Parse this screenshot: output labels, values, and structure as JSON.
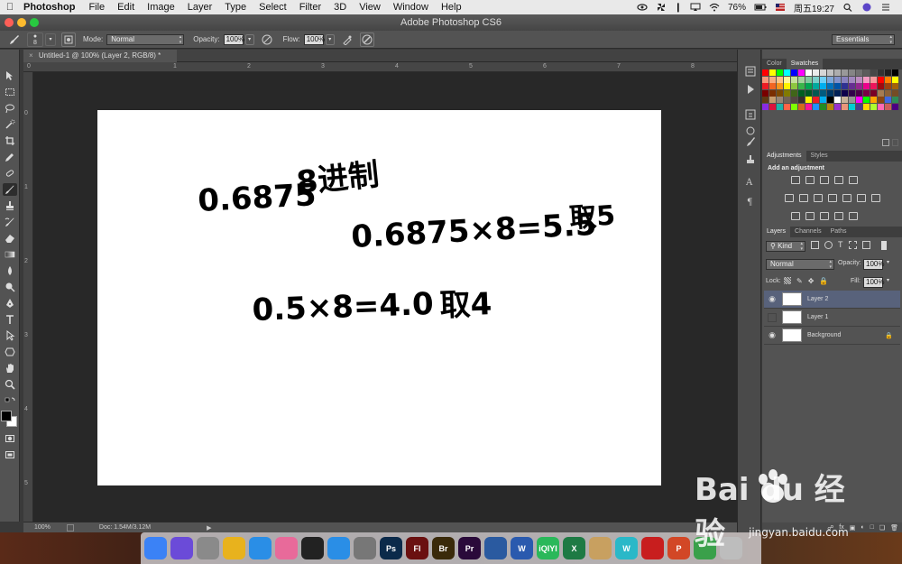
{
  "menubar": {
    "app_name": "Photoshop",
    "items": [
      "File",
      "Edit",
      "Image",
      "Layer",
      "Type",
      "Select",
      "Filter",
      "3D",
      "View",
      "Window",
      "Help"
    ],
    "battery": "76%",
    "clock": "周五19:27"
  },
  "window": {
    "title": "Adobe Photoshop CS6"
  },
  "options": {
    "brush_size": "8",
    "mode_label": "Mode:",
    "mode_value": "Normal",
    "opacity_label": "Opacity:",
    "opacity_value": "100%",
    "flow_label": "Flow:",
    "flow_value": "100%",
    "workspace": "Essentials"
  },
  "document": {
    "tab_label": "Untitled-1 @ 100% (Layer 2, RGB/8) *",
    "zoom": "100%",
    "doc_info": "Doc: 1.54M/3.12M"
  },
  "rulers": {
    "top": [
      "1",
      "2",
      "3",
      "4",
      "5",
      "6",
      "7",
      "8"
    ],
    "left": [
      "0",
      "1",
      "2",
      "3",
      "4",
      "5"
    ]
  },
  "canvas_text": {
    "line1": "0.6875",
    "line1_note": "8进制",
    "line2": "0.6875×8=5.5",
    "line2_note": "取5",
    "line3": "0.5×8=4.0",
    "line3_note": "取4"
  },
  "panels": {
    "color_tabs": [
      "Color",
      "Swatches"
    ],
    "adjust_tabs": [
      "Adjustments",
      "Styles"
    ],
    "adjust_title": "Add an adjustment",
    "layer_tabs": [
      "Layers",
      "Channels",
      "Paths"
    ],
    "kind_label": "Kind",
    "blend_mode": "Normal",
    "opacity_label": "Opacity:",
    "opacity_value": "100%",
    "lock_label": "Lock:",
    "fill_label": "Fill:",
    "fill_value": "100%",
    "layers": [
      {
        "name": "Layer 2",
        "visible": true,
        "selected": true
      },
      {
        "name": "Layer 1",
        "visible": false,
        "selected": false
      },
      {
        "name": "Background",
        "visible": true,
        "selected": false
      }
    ]
  },
  "dock": {
    "apps": [
      {
        "name": "finder",
        "label": "",
        "color": "#3b82f6"
      },
      {
        "name": "siri",
        "label": "",
        "color": "#6b4bd8"
      },
      {
        "name": "launchpad",
        "label": "",
        "color": "#8a8a8a"
      },
      {
        "name": "chrome",
        "label": "",
        "color": "#e8b21d"
      },
      {
        "name": "safari",
        "label": "",
        "color": "#2a8ee6"
      },
      {
        "name": "photos",
        "label": "",
        "color": "#e86a9a"
      },
      {
        "name": "qq",
        "label": "",
        "color": "#222222"
      },
      {
        "name": "appstore",
        "label": "",
        "color": "#2a8ee6"
      },
      {
        "name": "preferences",
        "label": "",
        "color": "#777777"
      },
      {
        "name": "photoshop",
        "label": "Ps",
        "color": "#0b2a4a"
      },
      {
        "name": "flash",
        "label": "Fl",
        "color": "#6a1010"
      },
      {
        "name": "bridge",
        "label": "Br",
        "color": "#3a2a0a"
      },
      {
        "name": "premiere",
        "label": "Pr",
        "color": "#2a0a3a"
      },
      {
        "name": "quicktime",
        "label": "",
        "color": "#2a5aa0"
      },
      {
        "name": "word",
        "label": "W",
        "color": "#2a5aae"
      },
      {
        "name": "iqiyi",
        "label": "iQIYI",
        "color": "#2ab85a"
      },
      {
        "name": "excel",
        "label": "X",
        "color": "#1e7a44"
      },
      {
        "name": "archive",
        "label": "",
        "color": "#c8a060"
      },
      {
        "name": "w-app",
        "label": "W",
        "color": "#2ab8c8"
      },
      {
        "name": "flashplayer",
        "label": "",
        "color": "#c81e1e"
      },
      {
        "name": "powerpoint",
        "label": "P",
        "color": "#d24726"
      },
      {
        "name": "camera",
        "label": "",
        "color": "#3aa04a"
      },
      {
        "name": "trash",
        "label": "",
        "color": "#bdbdbd"
      }
    ]
  },
  "watermark": {
    "brand": "Bai du 经验",
    "url": "jingyan.baidu.com"
  }
}
